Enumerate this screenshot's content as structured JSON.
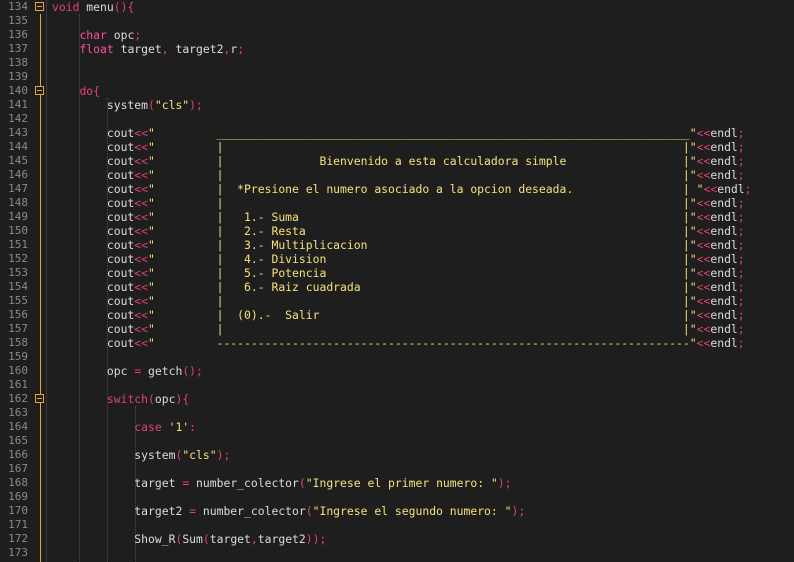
{
  "editor": {
    "lines": [
      {
        "n": "134",
        "fold": true,
        "tokens": [
          [
            "kw",
            "void"
          ],
          [
            "pl",
            " menu"
          ],
          [
            "op",
            "(){"
          ]
        ]
      },
      {
        "n": "135",
        "tokens": []
      },
      {
        "n": "136",
        "tokens": [
          [
            "pl",
            "    "
          ],
          [
            "ty",
            "char"
          ],
          [
            "pl",
            " opc"
          ],
          [
            "op",
            ";"
          ]
        ]
      },
      {
        "n": "137",
        "tokens": [
          [
            "pl",
            "    "
          ],
          [
            "ty",
            "float"
          ],
          [
            "pl",
            " target"
          ],
          [
            "op",
            ","
          ],
          [
            "pl",
            " target2"
          ],
          [
            "op",
            ","
          ],
          [
            "pl",
            "r"
          ],
          [
            "op",
            ";"
          ]
        ]
      },
      {
        "n": "138",
        "tokens": []
      },
      {
        "n": "139",
        "tokens": []
      },
      {
        "n": "140",
        "fold": true,
        "tokens": [
          [
            "pl",
            "    "
          ],
          [
            "kw",
            "do"
          ],
          [
            "op",
            "{"
          ]
        ]
      },
      {
        "n": "141",
        "tokens": [
          [
            "pl",
            "        system"
          ],
          [
            "op",
            "("
          ],
          [
            "str",
            "\"cls\""
          ],
          [
            "op",
            ");"
          ]
        ]
      },
      {
        "n": "142",
        "tokens": []
      },
      {
        "n": "143",
        "tokens": [
          [
            "pl",
            "        cout"
          ],
          [
            "op",
            "<<"
          ],
          [
            "str",
            "\"         _____________________________________________________________________\""
          ],
          [
            "op",
            "<<"
          ],
          [
            "pl",
            "endl"
          ],
          [
            "op",
            ";"
          ]
        ]
      },
      {
        "n": "144",
        "tokens": [
          [
            "pl",
            "        cout"
          ],
          [
            "op",
            "<<"
          ],
          [
            "str",
            "\"         |                                                                   |\""
          ],
          [
            "op",
            "<<"
          ],
          [
            "pl",
            "endl"
          ],
          [
            "op",
            ";"
          ]
        ]
      },
      {
        "n": "145",
        "tokens": [
          [
            "pl",
            "        cout"
          ],
          [
            "op",
            "<<"
          ],
          [
            "str",
            "\"         |              Bienvenido a esta calculadora simple                 |\""
          ],
          [
            "op",
            "<<"
          ],
          [
            "pl",
            "endl"
          ],
          [
            "op",
            ";"
          ]
        ]
      },
      {
        "n": "146",
        "tokens": [
          [
            "pl",
            "        cout"
          ],
          [
            "op",
            "<<"
          ],
          [
            "str",
            "\"         |                                                                   |\""
          ],
          [
            "op",
            "<<"
          ],
          [
            "pl",
            "endl"
          ],
          [
            "op",
            ";"
          ]
        ]
      },
      {
        "n": "147",
        "tokens": [
          [
            "pl",
            "        cout"
          ],
          [
            "op",
            "<<"
          ],
          [
            "str",
            "\"         |  *Presione el numero asociado a la opcion deseada.                | \""
          ],
          [
            "op",
            "<<"
          ],
          [
            "pl",
            "endl"
          ],
          [
            "op",
            ";"
          ]
        ]
      },
      {
        "n": "148",
        "tokens": [
          [
            "pl",
            "        cout"
          ],
          [
            "op",
            "<<"
          ],
          [
            "str",
            "\"         |                                                                   |\""
          ],
          [
            "op",
            "<<"
          ],
          [
            "pl",
            "endl"
          ],
          [
            "op",
            ";"
          ]
        ]
      },
      {
        "n": "149",
        "tokens": [
          [
            "pl",
            "        cout"
          ],
          [
            "op",
            "<<"
          ],
          [
            "str",
            "\"         |   1.- Suma                                                        |\""
          ],
          [
            "op",
            "<<"
          ],
          [
            "pl",
            "endl"
          ],
          [
            "op",
            ";"
          ]
        ]
      },
      {
        "n": "150",
        "tokens": [
          [
            "pl",
            "        cout"
          ],
          [
            "op",
            "<<"
          ],
          [
            "str",
            "\"         |   2.- Resta                                                       |\""
          ],
          [
            "op",
            "<<"
          ],
          [
            "pl",
            "endl"
          ],
          [
            "op",
            ";"
          ]
        ]
      },
      {
        "n": "151",
        "tokens": [
          [
            "pl",
            "        cout"
          ],
          [
            "op",
            "<<"
          ],
          [
            "str",
            "\"         |   3.- Multiplicacion                                              |\""
          ],
          [
            "op",
            "<<"
          ],
          [
            "pl",
            "endl"
          ],
          [
            "op",
            ";"
          ]
        ]
      },
      {
        "n": "152",
        "tokens": [
          [
            "pl",
            "        cout"
          ],
          [
            "op",
            "<<"
          ],
          [
            "str",
            "\"         |   4.- Division                                                    |\""
          ],
          [
            "op",
            "<<"
          ],
          [
            "pl",
            "endl"
          ],
          [
            "op",
            ";"
          ]
        ]
      },
      {
        "n": "153",
        "tokens": [
          [
            "pl",
            "        cout"
          ],
          [
            "op",
            "<<"
          ],
          [
            "str",
            "\"         |   5.- Potencia                                                    |\""
          ],
          [
            "op",
            "<<"
          ],
          [
            "pl",
            "endl"
          ],
          [
            "op",
            ";"
          ]
        ]
      },
      {
        "n": "154",
        "tokens": [
          [
            "pl",
            "        cout"
          ],
          [
            "op",
            "<<"
          ],
          [
            "str",
            "\"         |   6.- Raiz cuadrada                                               |\""
          ],
          [
            "op",
            "<<"
          ],
          [
            "pl",
            "endl"
          ],
          [
            "op",
            ";"
          ]
        ]
      },
      {
        "n": "155",
        "tokens": [
          [
            "pl",
            "        cout"
          ],
          [
            "op",
            "<<"
          ],
          [
            "str",
            "\"         |                                                                   |\""
          ],
          [
            "op",
            "<<"
          ],
          [
            "pl",
            "endl"
          ],
          [
            "op",
            ";"
          ]
        ]
      },
      {
        "n": "156",
        "tokens": [
          [
            "pl",
            "        cout"
          ],
          [
            "op",
            "<<"
          ],
          [
            "str",
            "\"         |  (0).-  Salir                                                     |\""
          ],
          [
            "op",
            "<<"
          ],
          [
            "pl",
            "endl"
          ],
          [
            "op",
            ";"
          ]
        ]
      },
      {
        "n": "157",
        "tokens": [
          [
            "pl",
            "        cout"
          ],
          [
            "op",
            "<<"
          ],
          [
            "str",
            "\"         |                                                                   |\""
          ],
          [
            "op",
            "<<"
          ],
          [
            "pl",
            "endl"
          ],
          [
            "op",
            ";"
          ]
        ]
      },
      {
        "n": "158",
        "tokens": [
          [
            "pl",
            "        cout"
          ],
          [
            "op",
            "<<"
          ],
          [
            "str",
            "\"         ---------------------------------------------------------------------\""
          ],
          [
            "op",
            "<<"
          ],
          [
            "pl",
            "endl"
          ],
          [
            "op",
            ";"
          ]
        ]
      },
      {
        "n": "159",
        "tokens": []
      },
      {
        "n": "160",
        "tokens": [
          [
            "pl",
            "        opc "
          ],
          [
            "op",
            "="
          ],
          [
            "pl",
            " getch"
          ],
          [
            "op",
            "();"
          ]
        ]
      },
      {
        "n": "161",
        "tokens": []
      },
      {
        "n": "162",
        "fold": true,
        "tokens": [
          [
            "pl",
            "        "
          ],
          [
            "kw",
            "switch"
          ],
          [
            "op",
            "("
          ],
          [
            "pl",
            "opc"
          ],
          [
            "op",
            "){"
          ]
        ]
      },
      {
        "n": "163",
        "tokens": []
      },
      {
        "n": "164",
        "tokens": [
          [
            "pl",
            "            "
          ],
          [
            "kw",
            "case"
          ],
          [
            "pl",
            " "
          ],
          [
            "str",
            "'1'"
          ],
          [
            "op",
            ":"
          ]
        ]
      },
      {
        "n": "165",
        "tokens": []
      },
      {
        "n": "166",
        "tokens": [
          [
            "pl",
            "            system"
          ],
          [
            "op",
            "("
          ],
          [
            "str",
            "\"cls\""
          ],
          [
            "op",
            ");"
          ]
        ]
      },
      {
        "n": "167",
        "tokens": []
      },
      {
        "n": "168",
        "tokens": [
          [
            "pl",
            "            target "
          ],
          [
            "op",
            "="
          ],
          [
            "pl",
            " number_colector"
          ],
          [
            "op",
            "("
          ],
          [
            "str",
            "\"Ingrese el primer numero: \""
          ],
          [
            "op",
            ");"
          ]
        ]
      },
      {
        "n": "169",
        "tokens": []
      },
      {
        "n": "170",
        "tokens": [
          [
            "pl",
            "            target2 "
          ],
          [
            "op",
            "="
          ],
          [
            "pl",
            " number_colector"
          ],
          [
            "op",
            "("
          ],
          [
            "str",
            "\"Ingrese el segundo numero: \""
          ],
          [
            "op",
            ");"
          ]
        ]
      },
      {
        "n": "171",
        "tokens": []
      },
      {
        "n": "172",
        "tokens": [
          [
            "pl",
            "            Show_R"
          ],
          [
            "op",
            "("
          ],
          [
            "pl",
            "Sum"
          ],
          [
            "op",
            "("
          ],
          [
            "pl",
            "target"
          ],
          [
            "op",
            ","
          ],
          [
            "pl",
            "target2"
          ],
          [
            "op",
            "));"
          ]
        ]
      },
      {
        "n": "173",
        "tokens": []
      }
    ]
  },
  "colors": {
    "background": "#1e1e1e",
    "line_numbers": "#8a8a8a",
    "keyword": "#e0426b",
    "type": "#ff4fa0",
    "string": "#f6e27a",
    "plain": "#dcdcdc",
    "fold_marker": "#e8a33d"
  }
}
